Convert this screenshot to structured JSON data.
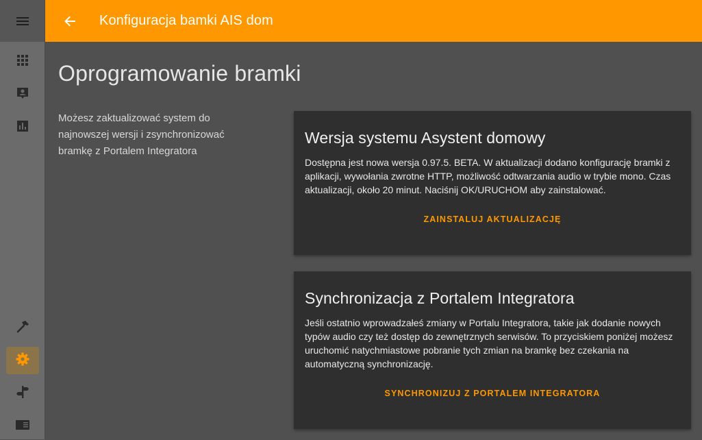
{
  "sidebar": {
    "menu_icon": "hamburger-menu-icon",
    "top_items": [
      {
        "icon": "grid-apps-icon"
      },
      {
        "icon": "account-box-icon"
      },
      {
        "icon": "bar-chart-icon"
      }
    ],
    "bottom_items": [
      {
        "icon": "hammer-icon"
      },
      {
        "icon": "gear-icon",
        "active": true
      },
      {
        "icon": "signpost-icon"
      },
      {
        "icon": "newspaper-icon"
      }
    ]
  },
  "header": {
    "back_icon": "arrow-left-icon",
    "title": "Konfiguracja bamki AIS dom"
  },
  "main": {
    "page_title": "Oprogramowanie bramki",
    "intro": "Możesz zaktualizować system do najnowszej wersji i zsynchronizować bramkę z Portalem Integratora"
  },
  "cards": {
    "update": {
      "title": "Wersja systemu Asystent domowy",
      "text": "Dostępna jest nowa wersja 0.97.5. BETA. W aktualizacji dodano konfigurację bramki z aplikacji, wywołania zwrotne HTTP, możliwość odtwarzania audio w trybie mono. Czas aktualizacji, około 20 minut. Naciśnij OK/URUCHOM aby zainstalować.",
      "action": "ZAINSTALUJ AKTUALIZACJĘ"
    },
    "sync": {
      "title": "Synchronizacja z Portalem Integratora",
      "text": "Jeśli ostatnio wprowadzałeś zmiany w Portalu Integratora, takie jak dodanie nowych typów audio czy też dostęp do zewnętrznych serwisów. To przyciskiem poniżej możesz uruchomić natychmiastowe pobranie tych zmian na bramkę bez czekania na automatyczną synchronizację.",
      "action": "SYNCHRONIZUJ Z PORTALEM INTEGRATORA"
    }
  },
  "colors": {
    "accent": "#ff9800",
    "card_bg": "#2f2f2f",
    "page_bg": "#505050",
    "sidebar_bg": "#6b6b6b",
    "active_item_bg": "#8b7449"
  }
}
